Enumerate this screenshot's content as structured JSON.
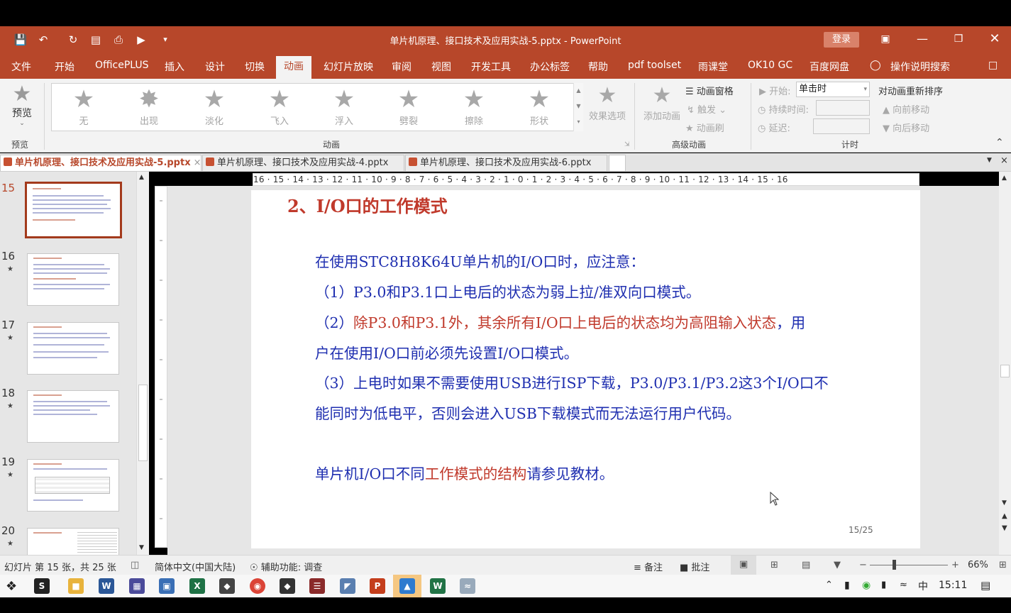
{
  "window": {
    "title": "单片机原理、接口技术及应用实战-5.pptx  -  PowerPoint",
    "login_label": "登录"
  },
  "menu_tabs": [
    "文件",
    "开始",
    "OfficePLUS",
    "插入",
    "设计",
    "切换",
    "动画",
    "幻灯片放映",
    "审阅",
    "视图",
    "开发工具",
    "办公标签",
    "帮助",
    "pdf toolset",
    "雨课堂",
    "OK10 GC",
    "百度网盘",
    "操作说明搜索"
  ],
  "active_tab": "动画",
  "ribbon": {
    "preview_label": "预览",
    "preview_group": "预览",
    "animations": [
      "无",
      "出现",
      "淡化",
      "飞入",
      "浮入",
      "劈裂",
      "擦除",
      "形状"
    ],
    "effect_options": "效果选项",
    "animation_group": "动画",
    "add_animation": "添加动画",
    "animation_pane": "动画窗格",
    "trigger": "触发",
    "animation_painter": "动画刷",
    "advanced_group": "高级动画",
    "start_label": "开始:",
    "start_value": "单击时",
    "duration_label": "持续时间:",
    "delay_label": "延迟:",
    "timing_group": "计时",
    "reorder_title": "对动画重新排序",
    "move_earlier": "向前移动",
    "move_later": "向后移动"
  },
  "doc_tabs": [
    "单片机原理、接口技术及应用实战-5.pptx",
    "单片机原理、接口技术及应用实战-4.pptx",
    "单片机原理、接口技术及应用实战-6.pptx"
  ],
  "thumbnails": [
    "15",
    "16",
    "17",
    "18",
    "19",
    "20"
  ],
  "ruler_text": "16 · 15 · 14 · 13 · 12 · 11 · 10 · 9 · 8 · 7 · 6 · 5 · 4 · 3 · 2 · 1 · 0 · 1 · 2 · 3 · 4 · 5 · 6 · 7 · 8 · 9 · 10 · 11 · 12 · 13 · 14 · 15 · 16",
  "slide": {
    "title": "2、I/O口的工作模式",
    "line1": "在使用STC8H8K64U单片机的I/O口时，应注意：",
    "line2": "（1）P3.0和P3.1口上电后的状态为弱上拉/准双向口模式。",
    "line3a": "（2）",
    "line3b": "除P3.0和P3.1外，其余所有I/O口上电后的状态均为高阻输入状态",
    "line3c": "，用",
    "line4": "户在使用I/O口前必须先设置I/O口模式。",
    "line5": "（3）上电时如果不需要使用USB进行ISP下载，P3.0/P3.1/P3.2这3个I/O口不",
    "line6": "能同时为低电平，否则会进入USB下载模式而无法运行用户代码。",
    "line7a": "单片机I/O口不同",
    "line7b": "工作模式的结构",
    "line7c": "请参见教材。",
    "page": "15/25"
  },
  "status": {
    "slide_info": "幻灯片 第 15 张，共 25 张",
    "language": "简体中文(中国大陆)",
    "accessibility": "辅助功能: 调查",
    "notes": "备注",
    "comments": "批注",
    "zoom": "66%"
  },
  "taskbar": {
    "time": "15:11"
  }
}
